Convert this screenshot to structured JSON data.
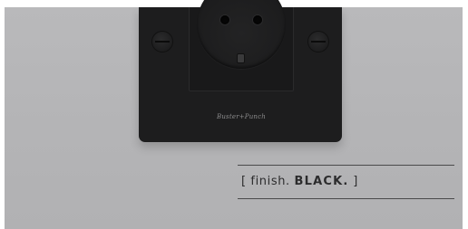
{
  "brand_logo": "Buster+Punch",
  "caption": {
    "open_bracket": "[",
    "prefix": "finish.",
    "finish_name": "BLACK.",
    "close_bracket": "]"
  },
  "colors": {
    "wall": "#b5b5b7",
    "plate": "#1d1d1e",
    "caption_text": "#2c2c2d",
    "rule": "#4a4a4b"
  }
}
